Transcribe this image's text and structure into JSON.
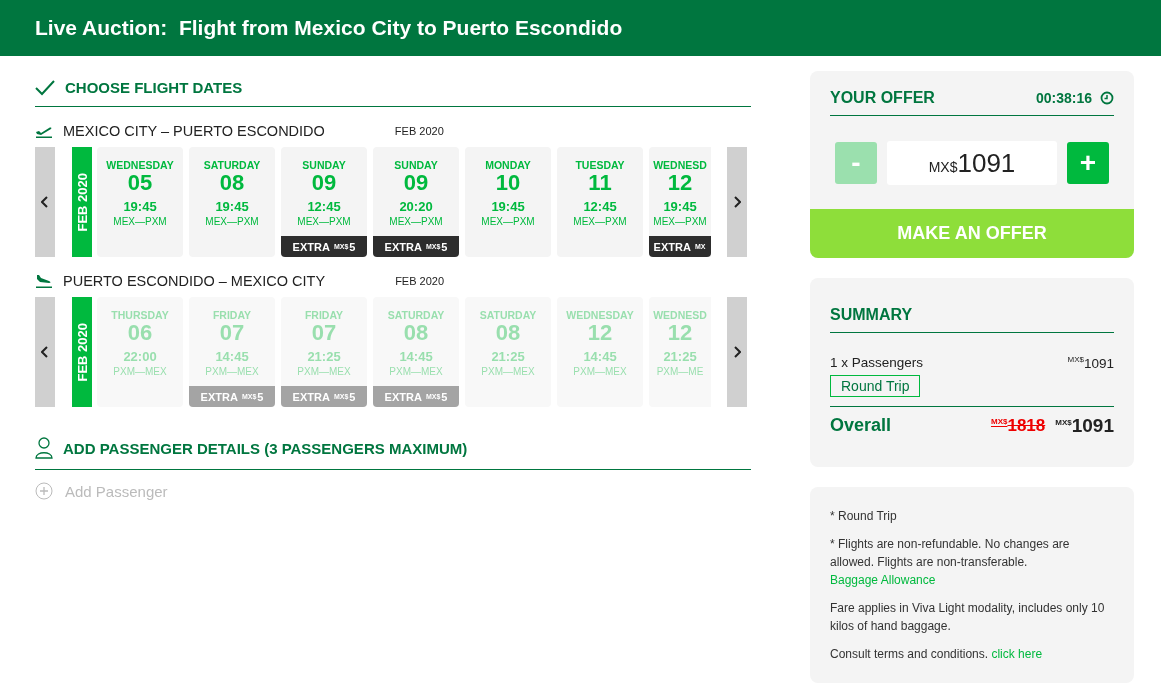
{
  "header": {
    "title": "Live Auction:  Flight from Mexico City to Puerto Escondido"
  },
  "dates_section": {
    "title": "CHOOSE FLIGHT DATES"
  },
  "routes": [
    {
      "kind": "outbound",
      "name": "MEXICO CITY – PUERTO ESCONDIDO",
      "month": "FEB 2020",
      "month_tab": "FEB 2020",
      "disabled": false,
      "flights": [
        {
          "day": "WEDNESDAY",
          "date": "05",
          "time": "19:45",
          "route": "MEX—PXM"
        },
        {
          "day": "SATURDAY",
          "date": "08",
          "time": "19:45",
          "route": "MEX—PXM"
        },
        {
          "day": "SUNDAY",
          "date": "09",
          "time": "12:45",
          "route": "MEX—PXM",
          "extra": {
            "label": "EXTRA",
            "currency": "MX$",
            "amount": "5"
          }
        },
        {
          "day": "SUNDAY",
          "date": "09",
          "time": "20:20",
          "route": "MEX—PXM",
          "extra": {
            "label": "EXTRA",
            "currency": "MX$",
            "amount": "5"
          }
        },
        {
          "day": "MONDAY",
          "date": "10",
          "time": "19:45",
          "route": "MEX—PXM"
        },
        {
          "day": "TUESDAY",
          "date": "11",
          "time": "12:45",
          "route": "MEX—PXM"
        },
        {
          "day": "WEDNESD",
          "date": "12",
          "time": "19:45",
          "route": "MEX—PXM",
          "extra": {
            "label": "EXTRA",
            "currency": "MX"
          }
        }
      ]
    },
    {
      "kind": "return",
      "name": "PUERTO ESCONDIDO – MEXICO CITY",
      "month": "FEB 2020",
      "month_tab": "FEB 2020",
      "disabled": true,
      "flights": [
        {
          "day": "THURSDAY",
          "date": "06",
          "time": "22:00",
          "route": "PXM—MEX"
        },
        {
          "day": "FRIDAY",
          "date": "07",
          "time": "14:45",
          "route": "PXM—MEX",
          "extra": {
            "label": "EXTRA",
            "currency": "MX$",
            "amount": "5"
          }
        },
        {
          "day": "FRIDAY",
          "date": "07",
          "time": "21:25",
          "route": "PXM—MEX",
          "extra": {
            "label": "EXTRA",
            "currency": "MX$",
            "amount": "5"
          }
        },
        {
          "day": "SATURDAY",
          "date": "08",
          "time": "14:45",
          "route": "PXM—MEX",
          "extra": {
            "label": "EXTRA",
            "currency": "MX$",
            "amount": "5"
          }
        },
        {
          "day": "SATURDAY",
          "date": "08",
          "time": "21:25",
          "route": "PXM—MEX"
        },
        {
          "day": "WEDNESDAY",
          "date": "12",
          "time": "14:45",
          "route": "PXM—MEX"
        },
        {
          "day": "WEDNESD",
          "date": "12",
          "time": "21:25",
          "route": "PXM—ME"
        }
      ]
    }
  ],
  "passengers_section": {
    "title": "ADD PASSENGER DETAILS (3 PASSENGERS MAXIMUM)",
    "add_label": "Add Passenger",
    "add_disabled": true
  },
  "offer": {
    "title": "YOUR OFFER",
    "timer": "00:38:16",
    "minus": "-",
    "minus_disabled": true,
    "plus": "+",
    "currency": "MX$",
    "amount": "1091",
    "submit": "MAKE AN OFFER"
  },
  "summary": {
    "title": "SUMMARY",
    "line_label": "1 x Passengers",
    "line_currency": "MX$",
    "line_amount": "1091",
    "tag": "Round Trip",
    "overall_label": "Overall",
    "old_currency": "MX$",
    "old_amount": "1818",
    "new_currency": "MX$",
    "new_amount": "1091"
  },
  "notes": [
    {
      "text": "* Round Trip"
    },
    {
      "text": "* Flights are non-refundable. No changes are allowed. Flights are non-transferable. ",
      "link": "Baggage Allowance"
    },
    {
      "text": "Fare applies in Viva Light modality, includes only 10 kilos of hand baggage."
    },
    {
      "text": "Consult terms and conditions. ",
      "link": "click here"
    }
  ]
}
